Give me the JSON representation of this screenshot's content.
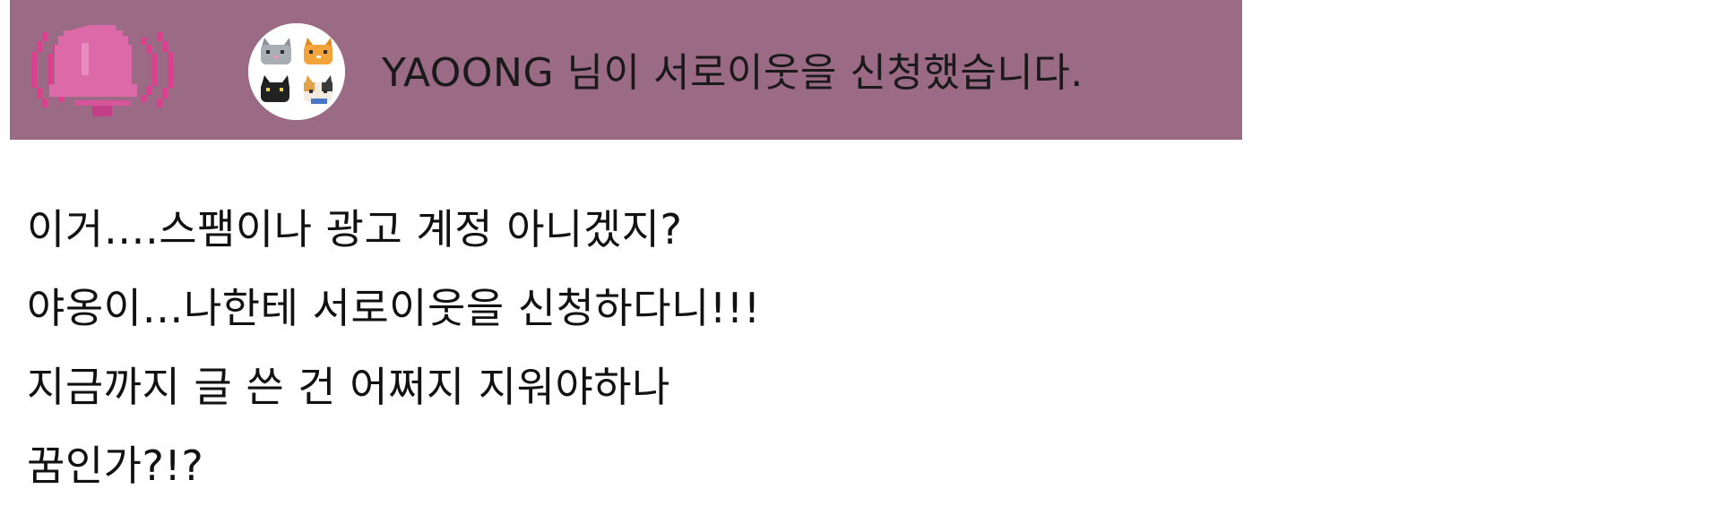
{
  "notification": {
    "message": "YAOONG 님이 서로이웃을 신청했습니다.",
    "icon": "bell-ringing-icon",
    "avatar_icon": "cat-avatar-icon",
    "background_color": "#9b6a84",
    "bell_color": "#dd6aa8"
  },
  "lines": [
    "이거….스팸이나 광고 계정 아니겠지?",
    "야옹이…나한테 서로이웃을 신청하다니!!!",
    "지금까지 글 쓴 건 어쩌지 지워야하나",
    "꿈인가?!?"
  ]
}
